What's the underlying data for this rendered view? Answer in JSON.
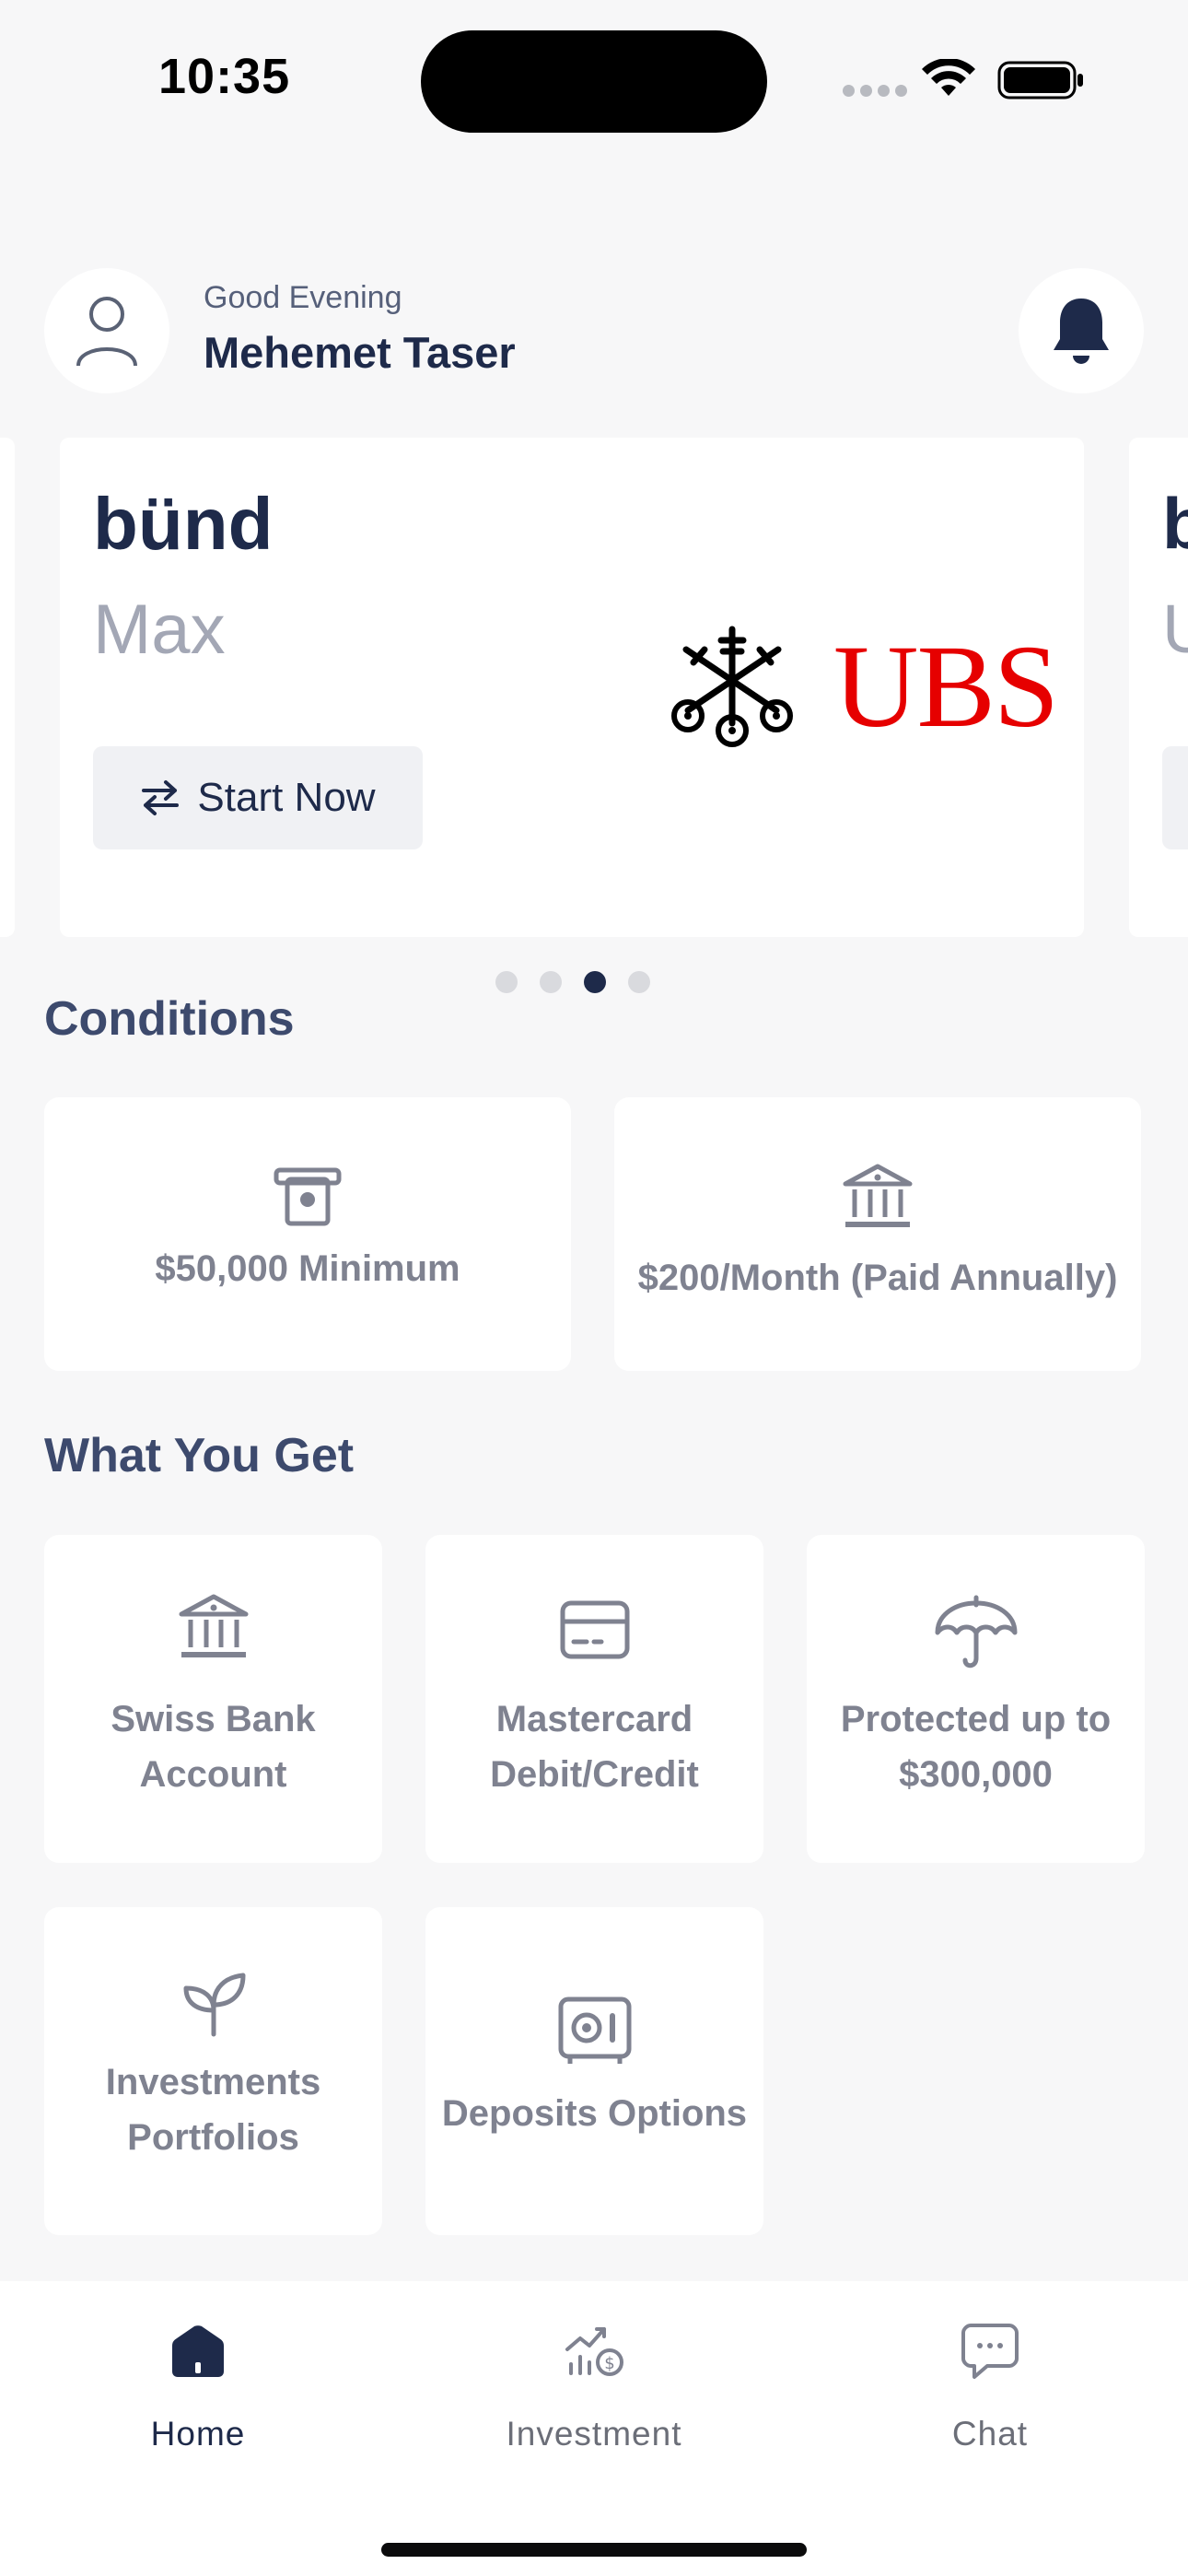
{
  "status_bar": {
    "time": "10:35"
  },
  "header": {
    "greeting": "Good Evening",
    "user_name": "Mehemet Taser",
    "avatar_icon": "user-icon",
    "notification_icon": "bell-icon"
  },
  "carousel": {
    "brand": "bünd",
    "tier": "Max",
    "start_button_label": "Start Now",
    "start_button_icon": "swap-arrows-icon",
    "partner_logo": "UBS",
    "peek_right_title": "b",
    "peek_right_sub": "U",
    "page_count": 4,
    "active_page": 3
  },
  "conditions": {
    "title": "Conditions",
    "items": [
      {
        "label": "$50,000 Minimum",
        "icon": "cash-withdraw-icon"
      },
      {
        "label": "$200/Month (Paid Annually)",
        "icon": "bank-icon"
      }
    ]
  },
  "features": {
    "title": "What You Get",
    "items": [
      {
        "line1": "Swiss Bank",
        "line2": "Account",
        "icon": "bank-icon"
      },
      {
        "line1": "Mastercard",
        "line2": "Debit/Credit",
        "icon": "credit-card-icon"
      },
      {
        "line1": "Protected up to",
        "line2": "$300,000",
        "icon": "umbrella-icon"
      },
      {
        "line1": "Investments",
        "line2": "Portfolios",
        "icon": "sprout-icon"
      },
      {
        "line1": "Deposits Options",
        "line2": "",
        "icon": "safe-icon"
      }
    ]
  },
  "tab_bar": {
    "tabs": [
      {
        "label": "Home",
        "icon": "home-icon",
        "active": true
      },
      {
        "label": "Investment",
        "icon": "investment-chart-icon",
        "active": false
      },
      {
        "label": "Chat",
        "icon": "chat-bubble-icon",
        "active": false
      }
    ]
  },
  "colors": {
    "background": "#f7f7f8",
    "navy": "#1e2a4a",
    "muted_text": "#7f8290",
    "ubs_red": "#e60000"
  }
}
